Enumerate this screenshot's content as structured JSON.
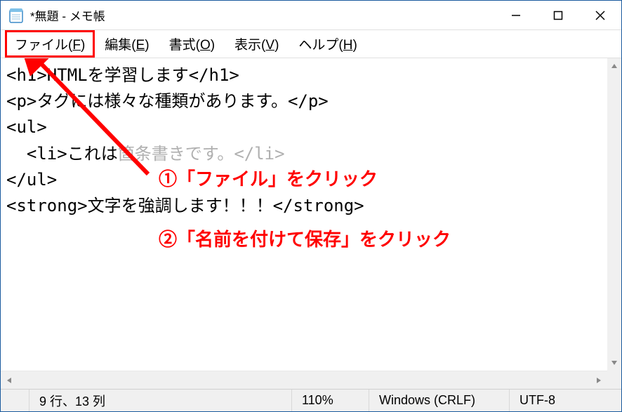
{
  "window": {
    "title": "*無題 - メモ帳"
  },
  "menubar": {
    "file": {
      "label": "ファイル(",
      "key": "F",
      "close": ")"
    },
    "edit": {
      "label": "編集(",
      "key": "E",
      "close": ")"
    },
    "format": {
      "label": "書式(",
      "key": "O",
      "close": ")"
    },
    "view": {
      "label": "表示(",
      "key": "V",
      "close": ")"
    },
    "help": {
      "label": "ヘルプ(",
      "key": "H",
      "close": ")"
    }
  },
  "editor": {
    "line1": "<h1>HTMLを学習します</h1>",
    "line2": "",
    "line3": "<p>タグには様々な種類があります。</p>",
    "line4": "",
    "line5": "<ul>",
    "line6a": "  <li>これは",
    "line6b": "箇条書きです。",
    "line6c": "</li>",
    "line7": "</ul>",
    "line8": "",
    "line9": "<strong>文字を強調します！！！</strong>"
  },
  "annotations": {
    "a1": "①「ファイル」をクリック",
    "a2": "②「名前を付けて保存」をクリック"
  },
  "statusbar": {
    "position": "9 行、13 列",
    "zoom": "110%",
    "lineending": "Windows (CRLF)",
    "encoding": "UTF-8"
  }
}
